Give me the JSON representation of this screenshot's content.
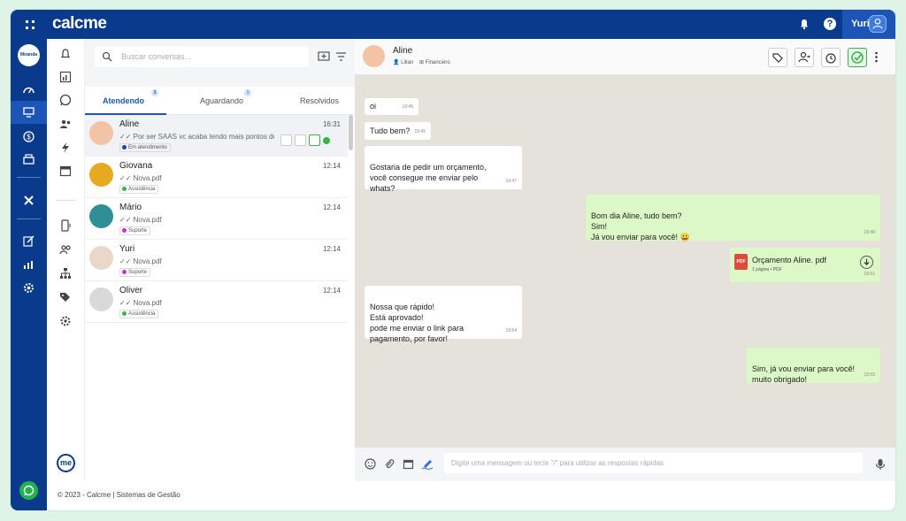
{
  "app": {
    "logo": "calcme",
    "user_name": "Yuri",
    "company_label": "Miranda",
    "help_glyph": "?",
    "footer": "© 2023 - Calcme | Sistemas de Gestão"
  },
  "icons": {
    "topbar": [
      "grid-icon",
      "bell-icon",
      "help-icon",
      "user-icon"
    ],
    "rail": [
      "dashboard-icon",
      "monitor-icon",
      "dollar-icon",
      "store-icon",
      "tools-icon",
      "edit-icon",
      "chart-icon",
      "settings-icon",
      "whatsapp-icon"
    ],
    "rail2": [
      "bell-icon",
      "report-icon",
      "whatsapp-icon",
      "contacts-icon",
      "lightning-icon",
      "calendar-icon",
      "mobile-icon",
      "team-icon",
      "org-icon",
      "tags-icon",
      "settings-icon"
    ]
  },
  "search": {
    "placeholder": "Buscar conversas..."
  },
  "tabs": [
    {
      "label": "Atendendo",
      "badge": "3"
    },
    {
      "label": "Aguardando",
      "badge": "1"
    },
    {
      "label": "Resolvidos"
    }
  ],
  "conversations": [
    {
      "name": "Aline",
      "time": "16:31",
      "preview": "Por ser SAAS vc acaba tendo mais pontos de...",
      "tag": "Em atendimento",
      "tag_color": "#1c3fb8"
    },
    {
      "name": "Giovana",
      "time": "12:14",
      "preview": "Nova.pdf",
      "tag": "Assistência",
      "tag_color": "#36b34a"
    },
    {
      "name": "Mário",
      "time": "12:14",
      "preview": "Nova.pdf",
      "tag": "Suporte",
      "tag_color": "#c233d1"
    },
    {
      "name": "Yuri",
      "time": "12:14",
      "preview": "Nova.pdf",
      "tag": "Suporte",
      "tag_color": "#c233d1"
    },
    {
      "name": "Oliver",
      "time": "12:14",
      "preview": "Nova.pdf",
      "tag": "Assistência",
      "tag_color": "#36b34a"
    }
  ],
  "chat": {
    "contact_name": "Aline",
    "agent": "Lilian",
    "department": "Financeiro",
    "messages": [
      {
        "dir": "in",
        "text": "oi",
        "time": "19:45"
      },
      {
        "dir": "in",
        "text": "Tudo bem?",
        "time": "19:45"
      },
      {
        "dir": "in",
        "text": "Gostaria de pedir um orçamento,\nvocê consegue me enviar pelo\nwhats?",
        "time": "19:47"
      },
      {
        "dir": "out",
        "text": "Bom dia Aline, tudo bem?\nSim!\nJá vou enviar para você! 😀",
        "time": "19:48"
      },
      {
        "dir": "out",
        "type": "file",
        "file_name": "Orçamento Aline. pdf",
        "file_meta": "1 página • PDF",
        "file_badge": "PDF",
        "time": "19:51"
      },
      {
        "dir": "in",
        "text": "Nossa que rápido!\nEstá aprovado!\npode me enviar o link para\npagamento, por favor!",
        "time": "19:54"
      },
      {
        "dir": "out",
        "text": "Sim, já vou enviar para você!\nmuito obrigado!",
        "time": "19:55"
      }
    ]
  },
  "composer": {
    "placeholder": "Digite uma mensagem ou tecle \"/\" para utilizar as respostas rápidas"
  },
  "colors": {
    "brand": "#0a3a8c",
    "accent": "#1c55b5",
    "incoming": "#ffffff",
    "outgoing": "#dcf8c6",
    "chat_bg": "#e5e2dc"
  }
}
